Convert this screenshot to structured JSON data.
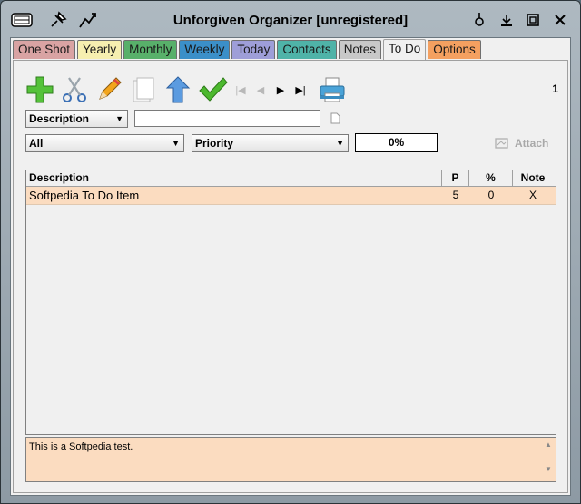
{
  "window": {
    "title": "Unforgiven Organizer [unregistered]",
    "title_icons_left": [
      "organizer-icon",
      "pin-icon",
      "stats-icon"
    ],
    "title_icons_right": [
      "tray-icon",
      "minimize-icon",
      "maximize-icon",
      "close-icon"
    ]
  },
  "tabs": [
    {
      "label": "One Shot",
      "color": "#d9a3a3"
    },
    {
      "label": "Yearly",
      "color": "#f6efb0"
    },
    {
      "label": "Monthly",
      "color": "#58b06a"
    },
    {
      "label": "Weekly",
      "color": "#3b8fc8"
    },
    {
      "label": "Today",
      "color": "#9e9ed8"
    },
    {
      "label": "Contacts",
      "color": "#4fb3a8"
    },
    {
      "label": "Notes",
      "color": "#c8c8c8"
    },
    {
      "label": "To Do",
      "color": "#f0f0f0",
      "active": true
    },
    {
      "label": "Options",
      "color": "#f4a060"
    }
  ],
  "toolbar": {
    "buttons": [
      "add-icon",
      "cut-icon",
      "edit-icon",
      "new-page-icon",
      "up-icon",
      "check-icon"
    ],
    "nav": [
      "first",
      "prev",
      "next",
      "last"
    ],
    "counter": "1"
  },
  "filters": {
    "field_select": "Description",
    "search_value": "",
    "category_select": "All",
    "sort_select": "Priority",
    "progress": "0%",
    "attach_label": "Attach"
  },
  "grid": {
    "columns": [
      "Description",
      "P",
      "%",
      "Note"
    ],
    "rows": [
      {
        "description": "Softpedia To Do Item",
        "p": "5",
        "percent": "0",
        "note": "X"
      }
    ]
  },
  "notes_text": "This is a Softpedia test."
}
